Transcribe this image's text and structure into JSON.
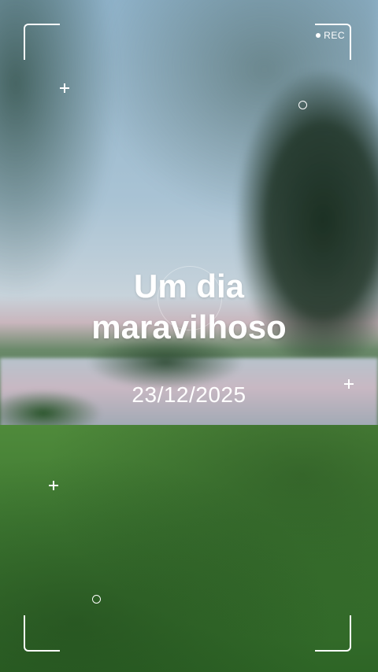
{
  "overlay": {
    "rec_label": "REC",
    "title_line1": "Um dia",
    "title_line2": "maravilhoso",
    "date": "23/12/2025"
  },
  "colors": {
    "overlay_white": "#ffffff",
    "grass_green": "#3f7a32",
    "sky_blue": "#a9c3d4"
  },
  "icons": [
    "rec-dot-icon",
    "plus-icon",
    "ring-icon",
    "viewfinder-corner"
  ]
}
